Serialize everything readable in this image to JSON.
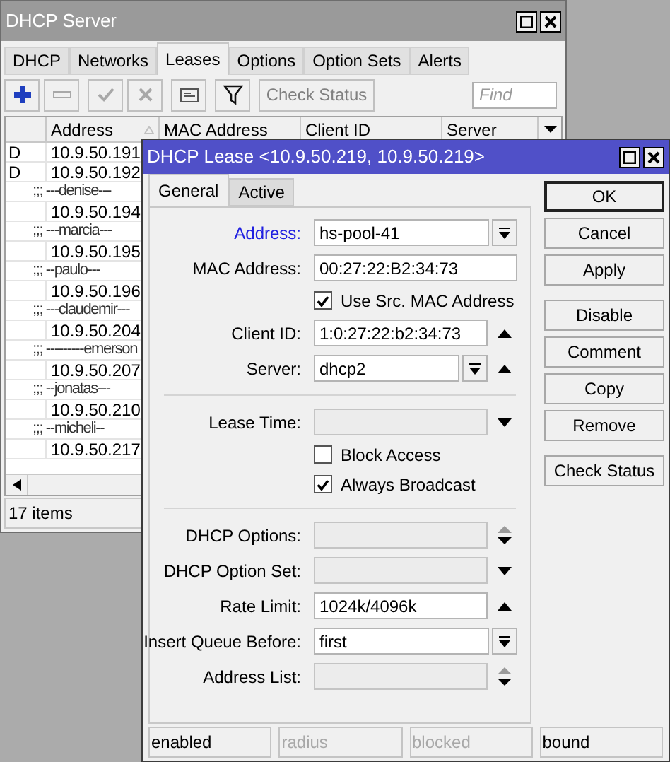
{
  "main_window": {
    "title": "DHCP Server",
    "tabs": [
      {
        "label": "DHCP",
        "selected": false
      },
      {
        "label": "Networks",
        "selected": false
      },
      {
        "label": "Leases",
        "selected": true
      },
      {
        "label": "Options",
        "selected": false
      },
      {
        "label": "Option Sets",
        "selected": false
      },
      {
        "label": "Alerts",
        "selected": false
      }
    ],
    "toolbar": {
      "check_status": {
        "label": "Check Status",
        "disabled": true
      },
      "find": {
        "placeholder": "Find"
      }
    },
    "table": {
      "columns": [
        {
          "label": "Address",
          "sorted": true
        },
        {
          "label": "MAC Address",
          "sorted": false
        },
        {
          "label": "Client ID",
          "sorted": false
        },
        {
          "label": "Server",
          "sorted": false
        }
      ],
      "rows": [
        {
          "kind": "lease",
          "flag": "D",
          "address": "10.9.50.191"
        },
        {
          "kind": "lease",
          "flag": "D",
          "address": "10.9.50.192"
        },
        {
          "kind": "comment",
          "text": ";;; ---denise---"
        },
        {
          "kind": "lease",
          "address": "10.9.50.194"
        },
        {
          "kind": "comment",
          "text": ";;; ---marcia---"
        },
        {
          "kind": "lease",
          "address": "10.9.50.195"
        },
        {
          "kind": "comment",
          "text": ";;; --paulo---"
        },
        {
          "kind": "lease",
          "address": "10.9.50.196"
        },
        {
          "kind": "comment",
          "text": ";;; ---claudemir---"
        },
        {
          "kind": "lease",
          "address": "10.9.50.204"
        },
        {
          "kind": "comment",
          "text": ";;; ---------emerson"
        },
        {
          "kind": "lease",
          "address": "10.9.50.207"
        },
        {
          "kind": "comment",
          "text": ";;; --jonatas---"
        },
        {
          "kind": "lease",
          "address": "10.9.50.210"
        },
        {
          "kind": "comment",
          "text": ";;; --micheli--"
        },
        {
          "kind": "lease",
          "address": "10.9.50.217"
        }
      ]
    },
    "status": "17 items"
  },
  "dialog": {
    "title": "DHCP Lease <10.9.50.219, 10.9.50.219>",
    "tabs": [
      {
        "label": "General",
        "selected": true
      },
      {
        "label": "Active",
        "selected": false
      }
    ],
    "fields": [
      {
        "kind": "field",
        "label": "Address:",
        "emphasized": true,
        "value": "hs-pool-41",
        "disabled": false,
        "dropdown": true,
        "up_arrow": false,
        "down_arrow": false
      },
      {
        "kind": "field",
        "label": "MAC Address:",
        "emphasized": false,
        "value": "00:27:22:B2:34:73",
        "disabled": false,
        "dropdown": false,
        "up_arrow": false,
        "down_arrow": false
      },
      {
        "kind": "checkbox",
        "label": "Use Src. MAC Address",
        "checked": true
      },
      {
        "kind": "field",
        "label": "Client ID:",
        "emphasized": false,
        "value": "1:0:27:22:b2:34:73",
        "disabled": false,
        "dropdown": false,
        "up_arrow": true,
        "down_arrow": false
      },
      {
        "kind": "field",
        "label": "Server:",
        "emphasized": false,
        "value": "dhcp2",
        "disabled": false,
        "dropdown": true,
        "up_arrow": true,
        "down_arrow": false
      },
      {
        "kind": "separator"
      },
      {
        "kind": "field",
        "label": "Lease Time:",
        "emphasized": false,
        "disabled": true,
        "dropdown": false,
        "up_arrow": false,
        "down_arrow": true
      },
      {
        "kind": "checkbox",
        "label": "Block Access",
        "checked": false
      },
      {
        "kind": "checkbox",
        "label": "Always Broadcast",
        "checked": true
      },
      {
        "kind": "separator"
      },
      {
        "kind": "field",
        "label": "DHCP Options:",
        "emphasized": false,
        "disabled": true,
        "dropdown": false,
        "up_arrow": true,
        "down_arrow": true
      },
      {
        "kind": "field",
        "label": "DHCP Option Set:",
        "emphasized": false,
        "disabled": true,
        "dropdown": false,
        "up_arrow": false,
        "down_arrow": true
      },
      {
        "kind": "field",
        "label": "Rate Limit:",
        "emphasized": false,
        "value": "1024k/4096k",
        "disabled": false,
        "dropdown": false,
        "up_arrow": true,
        "down_arrow": false
      },
      {
        "kind": "field",
        "label": "Insert Queue Before:",
        "emphasized": false,
        "value": "first",
        "disabled": false,
        "dropdown": true,
        "up_arrow": false,
        "down_arrow": false
      },
      {
        "kind": "field",
        "label": "Address List:",
        "emphasized": false,
        "disabled": true,
        "dropdown": false,
        "up_arrow": true,
        "down_arrow": true
      }
    ],
    "button_groups": [
      [
        {
          "label": "OK",
          "default": true
        },
        {
          "label": "Cancel",
          "default": false
        },
        {
          "label": "Apply",
          "default": false
        }
      ],
      [
        {
          "label": "Disable",
          "default": false
        },
        {
          "label": "Comment",
          "default": false
        },
        {
          "label": "Copy",
          "default": false
        },
        {
          "label": "Remove",
          "default": false
        }
      ],
      [
        {
          "label": "Check Status",
          "default": false
        }
      ]
    ],
    "status": [
      {
        "text": "enabled",
        "disabled": false
      },
      {
        "text": "radius",
        "disabled": true
      },
      {
        "text": "blocked",
        "disabled": true
      },
      {
        "text": "bound",
        "disabled": false
      }
    ]
  }
}
